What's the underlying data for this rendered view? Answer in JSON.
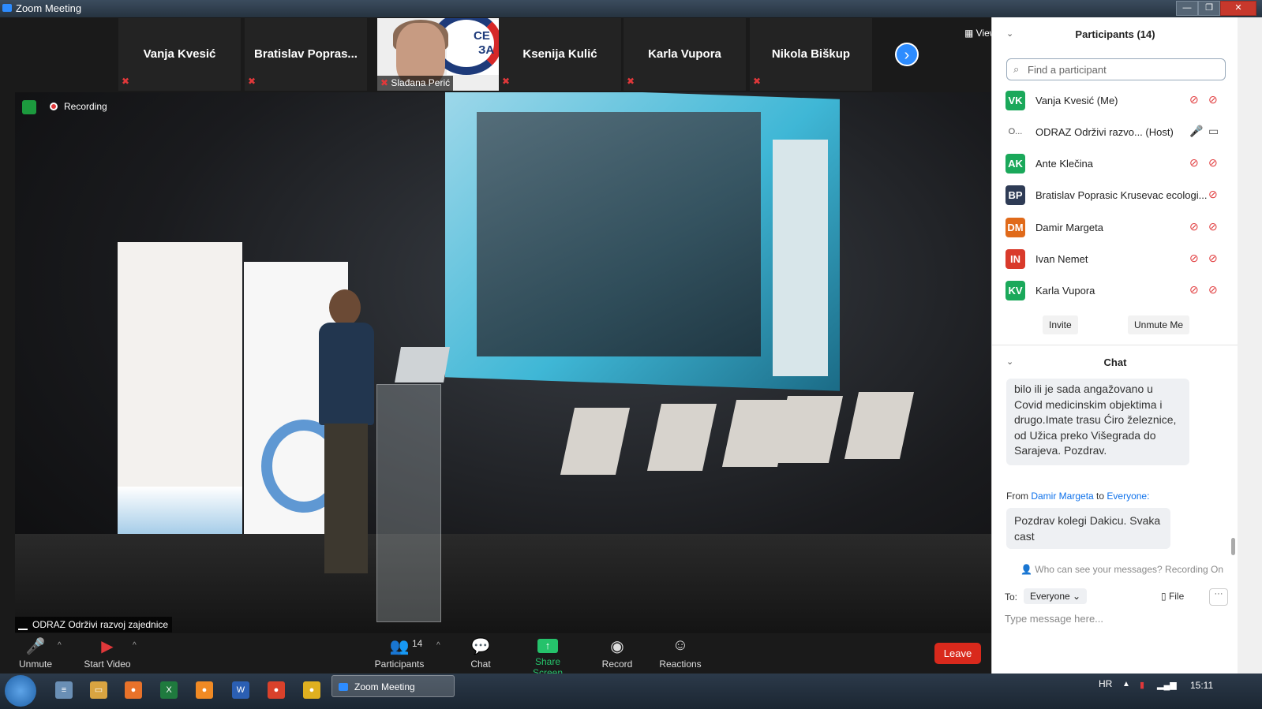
{
  "window": {
    "title": "Zoom Meeting",
    "minimize": "—",
    "maximize": "❐",
    "close": "✕"
  },
  "strip": {
    "thumbs": [
      {
        "name": "Vanja Kvesić"
      },
      {
        "name": "Bratislav  Popras..."
      },
      {
        "name": "Ksenija Kulić"
      },
      {
        "name": "Karla Vupora"
      },
      {
        "name": "Nikola Biškup"
      }
    ],
    "video_thumb": {
      "name": "Slađana Perić",
      "sign_line1": "CE",
      "sign_line2": "ЗА"
    },
    "next_icon": "›",
    "view_label": "View"
  },
  "main": {
    "recording_label": "Recording",
    "active_speaker": "ODRAZ Održivi razvoj zajednice"
  },
  "toolbar": {
    "unmute": "Unmute",
    "start_video": "Start Video",
    "participants": "Participants",
    "participants_count": "14",
    "chat": "Chat",
    "share_screen": "Share Screen",
    "record": "Record",
    "reactions": "Reactions",
    "leave": "Leave"
  },
  "participants_panel": {
    "title": "Participants (14)",
    "search_placeholder": "Find a participant",
    "rows": [
      {
        "initials": "VK",
        "name": "Vanja Kvesić (Me)",
        "color": "#1aa85a"
      },
      {
        "initials": "O...",
        "name": "ODRAZ Održivi razvo... (Host)",
        "color": "#ffffff"
      },
      {
        "initials": "AK",
        "name": "Ante Klečina",
        "color": "#1aa85a"
      },
      {
        "initials": "BP",
        "name": "Bratislav Poprasic Krusevac ecologi...",
        "color": "#2e3b55"
      },
      {
        "initials": "DM",
        "name": "Damir Margeta",
        "color": "#e06a1a"
      },
      {
        "initials": "IN",
        "name": "Ivan Nemet",
        "color": "#d93a2b"
      },
      {
        "initials": "KV",
        "name": "Karla Vupora",
        "color": "#1aa85a"
      }
    ],
    "invite": "Invite",
    "unmute_me": "Unmute Me"
  },
  "chat_panel": {
    "title": "Chat",
    "msg1": "bilo ili je sada angažovano u Covid medicinskim objektima i drugo.Imate trasu Ćiro železnice, od Užica  preko Višegrada do Sarajeva. Pozdrav.",
    "from_prefix": "From",
    "from_name": "Damir Margeta",
    "to_word": "to",
    "to_name": "Everyone:",
    "msg2": "Pozdrav kolegi Dakicu. Svaka cast",
    "who_can_see": "Who can see your messages? Recording On",
    "to_label": "To:",
    "to_value": "Everyone",
    "file_label": "File",
    "more": "···",
    "input_placeholder": "Type message here..."
  },
  "taskbar": {
    "app_label": "Zoom Meeting",
    "lang": "HR",
    "clock": "15:11",
    "icons": [
      {
        "name": "notepad",
        "label": "≡",
        "color": "#6a8fb5"
      },
      {
        "name": "folder",
        "label": "▭",
        "color": "#d9a441"
      },
      {
        "name": "firefox",
        "label": "●",
        "color": "#e8722a"
      },
      {
        "name": "excel",
        "label": "X",
        "color": "#1f7a3e"
      },
      {
        "name": "app",
        "label": "●",
        "color": "#f08a24"
      },
      {
        "name": "word",
        "label": "W",
        "color": "#2b5fb3"
      },
      {
        "name": "chrome",
        "label": "●",
        "color": "#d9412b"
      },
      {
        "name": "chrome2",
        "label": "●",
        "color": "#e0b020"
      }
    ]
  }
}
